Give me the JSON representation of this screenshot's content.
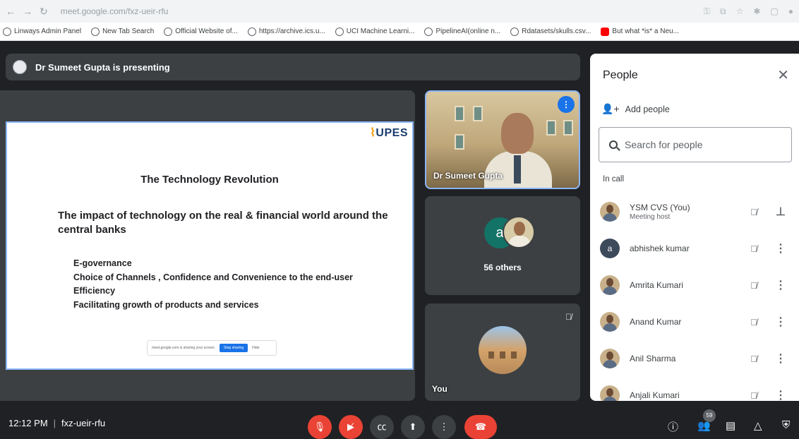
{
  "browser": {
    "url": "meet.google.com/fxz-ueir-rfu",
    "bookmarks": [
      {
        "label": "Linways Admin Panel"
      },
      {
        "label": "New Tab Search"
      },
      {
        "label": "Official Website of..."
      },
      {
        "label": "https://archive.ics.u..."
      },
      {
        "label": "UCI Machine Learni..."
      },
      {
        "label": "PipelineAI(online n..."
      },
      {
        "label": "Rdatasets/skulls.csv..."
      },
      {
        "label": "But what *is* a Neu..."
      }
    ]
  },
  "presenting": {
    "text": "Dr Sumeet Gupta is presenting"
  },
  "slide": {
    "logo": "UPES",
    "title": "The Technology Revolution",
    "subtitle": "The impact of technology on the real & financial world around the central banks",
    "bullets": [
      "E-governance",
      "Choice of Channels , Confidence and Convenience  to the end-user",
      "Efficiency",
      "Facilitating growth of products and services"
    ],
    "share_text": "meet.google.com is sharing your screen.",
    "stop_label": "Stop sharing",
    "hide_label": "Hide"
  },
  "tiles": {
    "presenter_name": "Dr Sumeet Gupta",
    "others_letter": "a",
    "others_label": "56 others",
    "you_label": "You"
  },
  "people_panel": {
    "title": "People",
    "add_label": "Add people",
    "search_placeholder": "Search for people",
    "section": "In call",
    "participants": [
      {
        "name": "YSM CVS (You)",
        "role": "Meeting host",
        "avatar": "photo"
      },
      {
        "name": "abhishek kumar",
        "role": "",
        "avatar": "letter",
        "letter": "a"
      },
      {
        "name": "Amrita Kumari",
        "role": "",
        "avatar": "photo"
      },
      {
        "name": "Anand Kumar",
        "role": "",
        "avatar": "photo"
      },
      {
        "name": "Anil Sharma",
        "role": "",
        "avatar": "photo"
      },
      {
        "name": "Anjali Kumari",
        "role": "",
        "avatar": "photo"
      }
    ]
  },
  "bottom": {
    "time": "12:12 PM",
    "meeting_code": "fxz-ueir-rfu",
    "people_count": "59"
  },
  "colors": {
    "accent": "#1a73e8",
    "danger": "#ea4335",
    "surface": "#3c4043",
    "background": "#202124"
  }
}
